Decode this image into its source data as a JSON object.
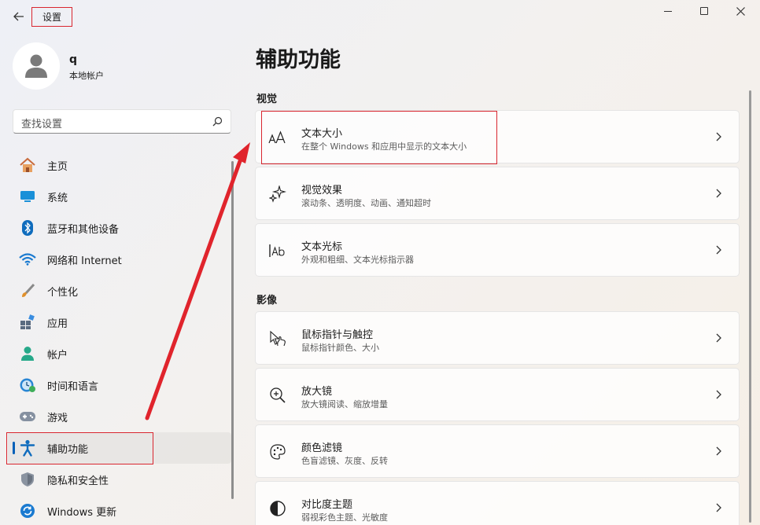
{
  "window": {
    "app_title": "设置",
    "back_icon": "arrow-left-icon",
    "controls": [
      "minimize-icon",
      "maximize-icon",
      "close-icon"
    ]
  },
  "profile": {
    "name": "q",
    "account_type": "本地帐户"
  },
  "search": {
    "placeholder": "查找设置",
    "icon": "search-icon"
  },
  "nav": {
    "items": [
      {
        "label": "主页",
        "icon": "home-icon"
      },
      {
        "label": "系统",
        "icon": "monitor-icon"
      },
      {
        "label": "蓝牙和其他设备",
        "icon": "bluetooth-icon"
      },
      {
        "label": "网络和 Internet",
        "icon": "wifi-icon"
      },
      {
        "label": "个性化",
        "icon": "brush-icon"
      },
      {
        "label": "应用",
        "icon": "apps-icon"
      },
      {
        "label": "帐户",
        "icon": "person-icon"
      },
      {
        "label": "时间和语言",
        "icon": "clock-globe-icon"
      },
      {
        "label": "游戏",
        "icon": "gamepad-icon"
      },
      {
        "label": "辅助功能",
        "icon": "accessibility-icon",
        "active": true
      },
      {
        "label": "隐私和安全性",
        "icon": "shield-icon"
      },
      {
        "label": "Windows 更新",
        "icon": "update-icon"
      }
    ]
  },
  "main": {
    "title": "辅助功能",
    "sections": [
      {
        "label": "视觉"
      },
      {
        "label": "影像"
      }
    ],
    "cards": [
      {
        "title": "文本大小",
        "desc": "在整个 Windows 和应用中显示的文本大小",
        "icon": "text-size-icon"
      },
      {
        "title": "视觉效果",
        "desc": "滚动条、透明度、动画、通知超时",
        "icon": "sparkle-icon"
      },
      {
        "title": "文本光标",
        "desc": "外观和粗细、文本光标指示器",
        "icon": "text-cursor-icon"
      },
      {
        "title": "鼠标指针与触控",
        "desc": "鼠标指针颜色、大小",
        "icon": "pointer-hand-icon"
      },
      {
        "title": "放大镜",
        "desc": "放大镜阅读、缩放增量",
        "icon": "magnifier-icon"
      },
      {
        "title": "颜色滤镜",
        "desc": "色盲滤镜、灰度、反转",
        "icon": "palette-icon"
      },
      {
        "title": "对比度主题",
        "desc": "弱视彩色主题、光敏度",
        "icon": "contrast-icon"
      }
    ]
  },
  "colors": {
    "accent": "#005fb8",
    "annotation": "#d9262f"
  }
}
